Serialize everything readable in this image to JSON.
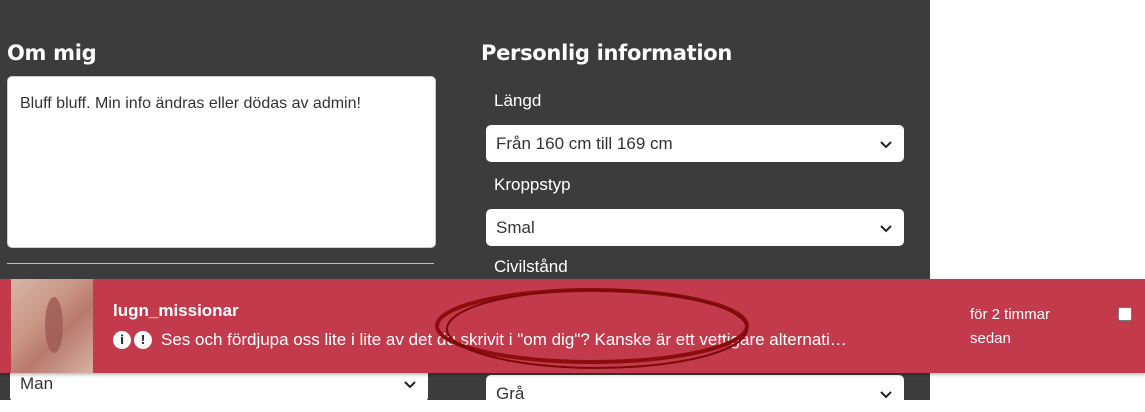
{
  "about": {
    "title": "Om mig",
    "text": "Bluff bluff. Min info ändras eller dödas av admin!"
  },
  "personal": {
    "title": "Personlig information",
    "fields": [
      {
        "label": "Längd",
        "value": "Från 160 cm till 169 cm"
      },
      {
        "label": "Kroppstyp",
        "value": "Smal"
      },
      {
        "label": "Civilstånd",
        "value": ""
      }
    ],
    "lower_left_value": "Man",
    "lower_right_value": "Grå"
  },
  "notification": {
    "username": "lugn_missionar",
    "message": "Ses och fördjupa oss lite i lite av det du skrivit i \"om dig\"? Kanske är ett vettigare alternati…",
    "time": "för 2 timmar sedan",
    "badge1": "i",
    "badge2": "!"
  },
  "colors": {
    "panel": "#3c3c3c",
    "notification": "#c33a4c",
    "annotation": "#8b0d0d"
  }
}
